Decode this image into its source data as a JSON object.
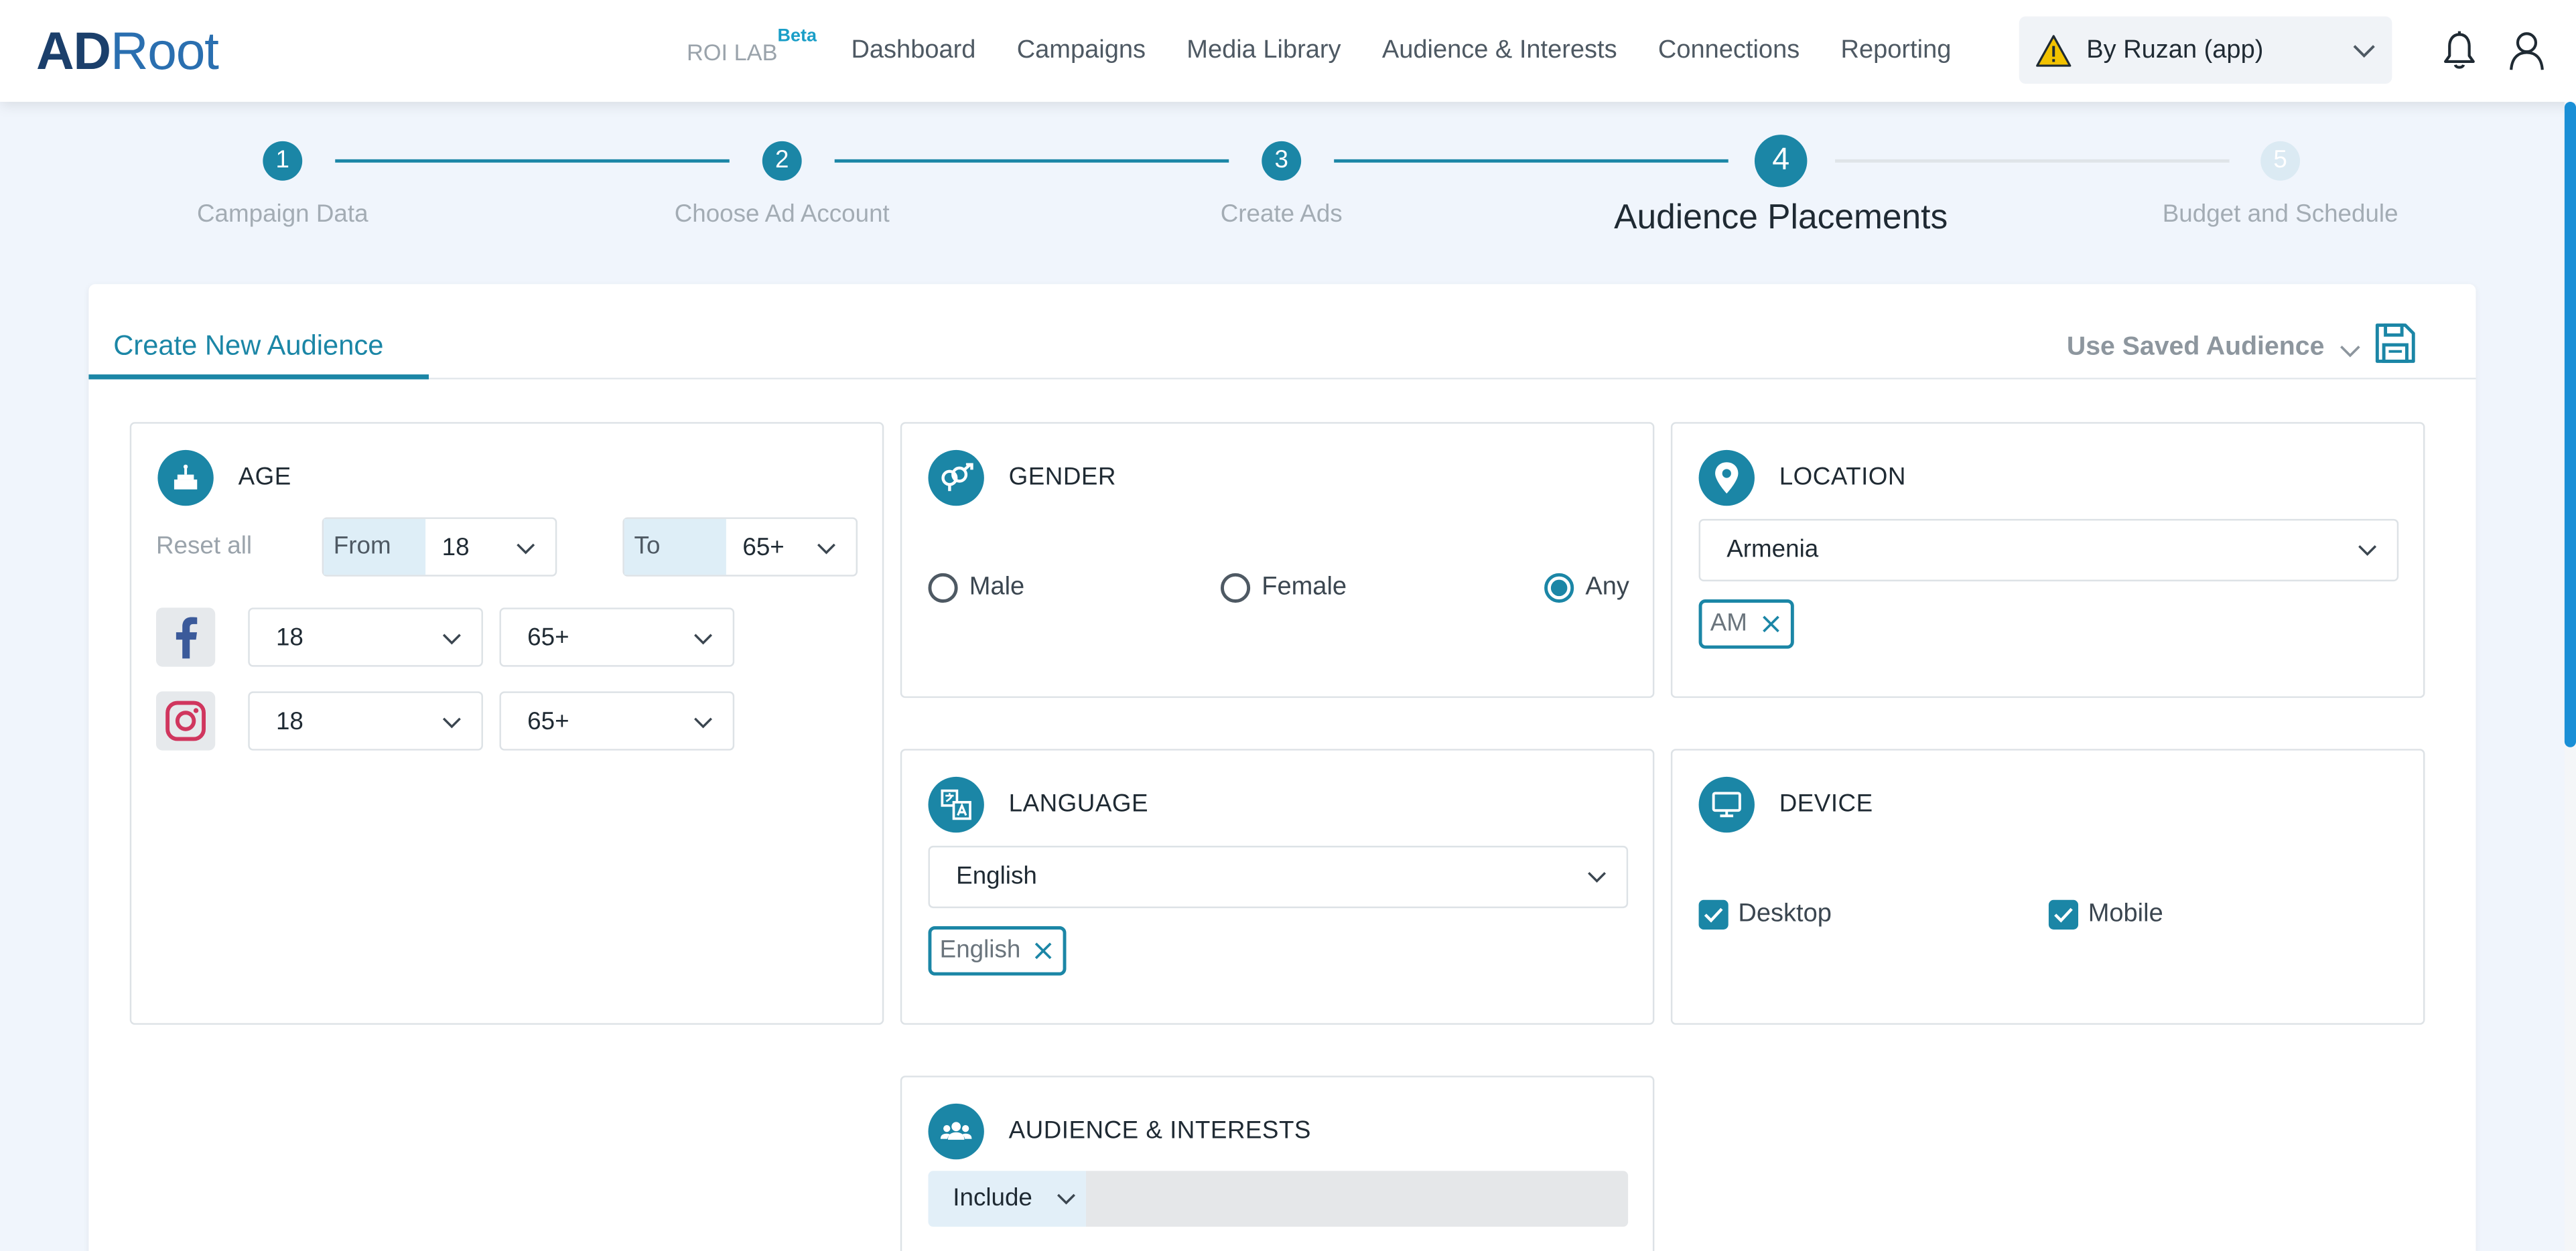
{
  "header": {
    "logo_a": "AD",
    "logo_b": "Root",
    "roi_lab": "ROI LAB",
    "roi_beta": "Beta",
    "nav": [
      "Dashboard",
      "Campaigns",
      "Media Library",
      "Audience & Interests",
      "Connections",
      "Reporting"
    ],
    "account": "By Ruzan (app)"
  },
  "stepper": {
    "steps": [
      {
        "num": "1",
        "label": "Campaign Data"
      },
      {
        "num": "2",
        "label": "Choose Ad Account"
      },
      {
        "num": "3",
        "label": "Create Ads"
      },
      {
        "num": "4",
        "label": "Audience Placements"
      },
      {
        "num": "5",
        "label": "Budget and Schedule"
      }
    ],
    "active_index": 3
  },
  "card": {
    "tab_create": "Create New Audience",
    "use_saved": "Use Saved Audience"
  },
  "age": {
    "title": "AGE",
    "reset": "Reset all",
    "from_label": "From",
    "from_value": "18",
    "to_label": "To",
    "to_value": "65+",
    "facebook_from": "18",
    "facebook_to": "65+",
    "instagram_from": "18",
    "instagram_to": "65+"
  },
  "gender": {
    "title": "GENDER",
    "options": [
      "Male",
      "Female",
      "Any"
    ],
    "selected": "Any"
  },
  "location": {
    "title": "LOCATION",
    "value": "Armenia",
    "chip": "AM"
  },
  "language": {
    "title": "LANGUAGE",
    "value": "English",
    "chip": "English"
  },
  "device": {
    "title": "DEVICE",
    "desktop": "Desktop",
    "mobile": "Mobile",
    "desktop_checked": true,
    "mobile_checked": true
  },
  "audience": {
    "title": "AUDIENCE & INTERESTS",
    "mode": "Include"
  },
  "colors": {
    "accent": "#1b86a6",
    "scroll": "#1a8fd6",
    "warning": "#f2c200"
  }
}
